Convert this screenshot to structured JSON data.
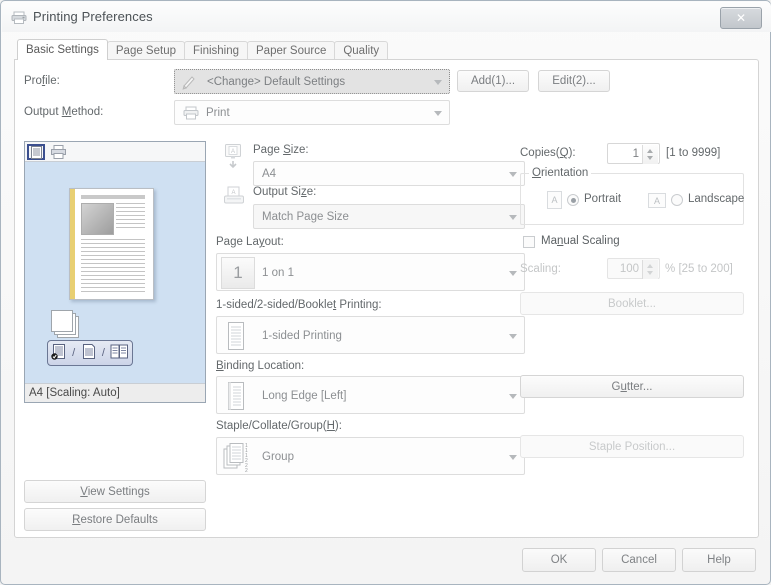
{
  "window": {
    "title": "Printing Preferences",
    "title_icon": "printer-icon",
    "close_label": "✕"
  },
  "tabs": [
    {
      "label": "Basic Settings",
      "active": true
    },
    {
      "label": "Page Setup",
      "active": false
    },
    {
      "label": "Finishing",
      "active": false
    },
    {
      "label": "Paper Source",
      "active": false
    },
    {
      "label": "Quality",
      "active": false
    }
  ],
  "profile": {
    "label": "Profile:",
    "value": "<Change> Default Settings",
    "icon": "pencil-icon",
    "add_button": "Add(1)...",
    "edit_button": "Edit(2)..."
  },
  "output_method": {
    "label": "Output Method:",
    "value": "Print",
    "icon": "printer-icon"
  },
  "preview": {
    "toolbar": [
      {
        "name": "document-view-icon",
        "selected": true
      },
      {
        "name": "printer-view-icon",
        "selected": false
      }
    ],
    "mode_icons": [
      {
        "name": "one-sided-icon",
        "checked": true
      },
      {
        "name": "two-sided-icon",
        "checked": false
      },
      {
        "name": "booklet-icon",
        "checked": false
      }
    ],
    "separator": "/",
    "status": "A4 [Scaling: Auto]",
    "view_settings_button": "View Settings",
    "restore_defaults_button": "Restore Defaults"
  },
  "settings": {
    "page_size": {
      "label": "Page Size:",
      "value": "A4",
      "icon": "monitor-down-icon"
    },
    "output_size": {
      "label": "Output Size:",
      "value": "Match Page Size",
      "icon": "printer-page-icon"
    },
    "page_layout": {
      "label": "Page Layout:",
      "value": "1 on 1",
      "icon": "1"
    },
    "sided_printing": {
      "label": "1-sided/2-sided/Booklet Printing:",
      "value": "1-sided Printing",
      "icon": "page-icon"
    },
    "binding_location": {
      "label": "Binding Location:",
      "value": "Long Edge [Left]",
      "icon": "page-icon"
    },
    "staple_collate_group": {
      "label": "Staple/Collate/Group(H):",
      "value": "Group",
      "icon": "group-pages-icon"
    }
  },
  "right": {
    "copies": {
      "label": "Copies(Q):",
      "value": "1",
      "range": "[1 to 9999]"
    },
    "orientation": {
      "title": "Orientation",
      "options": [
        {
          "label": "Portrait",
          "selected": true,
          "icon": "portrait-icon",
          "glyph": "A"
        },
        {
          "label": "Landscape",
          "selected": false,
          "icon": "landscape-icon",
          "glyph": "A"
        }
      ]
    },
    "manual_scaling": {
      "label": "Manual Scaling",
      "checked": false
    },
    "scaling": {
      "label": "Scaling:",
      "value": "100",
      "unit": "%",
      "range": "[25 to 200]",
      "disabled": true
    },
    "booklet_button": {
      "label": "Booklet...",
      "disabled": true
    },
    "gutter_button": {
      "label": "Gutter...",
      "disabled": false
    },
    "staple_position_button": {
      "label": "Staple Position...",
      "disabled": true
    }
  },
  "footer": {
    "ok": "OK",
    "cancel": "Cancel",
    "help": "Help"
  },
  "colors": {
    "preview_bg": "#cfe0f2",
    "binding_edge": "#e8cf72",
    "tab_active_bg": "#ffffff",
    "selection_border": "#3b4f8f"
  }
}
